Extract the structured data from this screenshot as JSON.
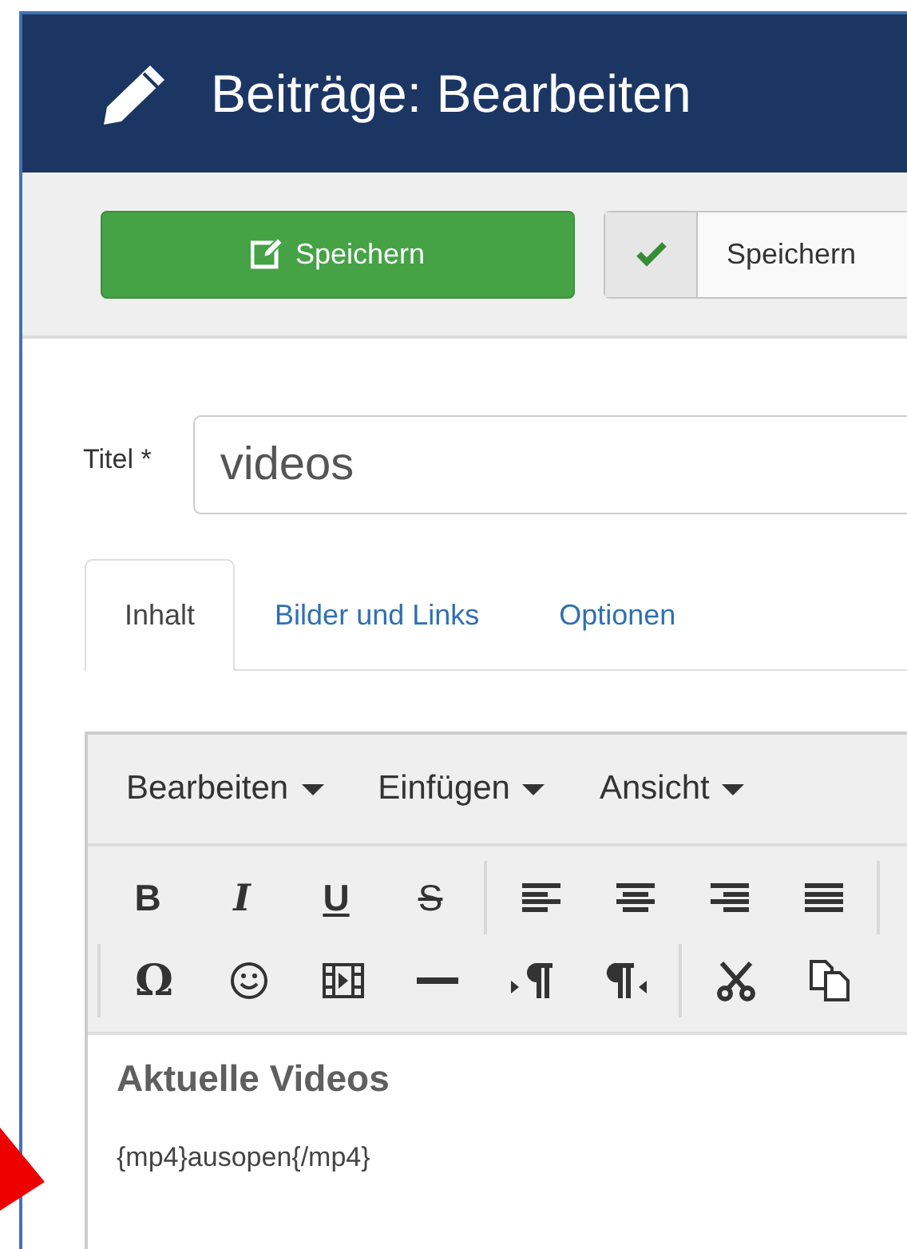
{
  "header": {
    "title": "Beiträge: Bearbeiten"
  },
  "toolbar": {
    "buttons": [
      {
        "kind": "primary",
        "label": "Speichern"
      },
      {
        "kind": "check",
        "label": "Speichern"
      }
    ]
  },
  "title_field": {
    "label": "Titel *",
    "value": "videos"
  },
  "tabs": [
    {
      "label": "Inhalt",
      "selected": true
    },
    {
      "label": "Bilder und Links",
      "selected": false
    },
    {
      "label": "Optionen",
      "selected": false
    }
  ],
  "editor": {
    "menus": [
      "Bearbeiten",
      "Einfügen",
      "Ansicht"
    ],
    "format_toolbar": [
      {
        "kind": "bold",
        "text": "B"
      },
      {
        "kind": "italic",
        "text": "I"
      },
      {
        "kind": "underline",
        "text": "U"
      },
      {
        "kind": "strike",
        "text": "S"
      },
      {
        "kind": "sep"
      },
      {
        "kind": "align-left"
      },
      {
        "kind": "align-center"
      },
      {
        "kind": "align-right"
      },
      {
        "kind": "justify"
      },
      {
        "kind": "sep"
      }
    ],
    "insert_toolbar": [
      {
        "kind": "sep"
      },
      {
        "kind": "special",
        "text": "Ω"
      },
      {
        "kind": "smiley"
      },
      {
        "kind": "film"
      },
      {
        "kind": "hr"
      },
      {
        "kind": "ltr"
      },
      {
        "kind": "rtl"
      },
      {
        "kind": "sep"
      },
      {
        "kind": "cut"
      },
      {
        "kind": "copy"
      }
    ],
    "heading": "Aktuelle Videos",
    "paragraph": "{mp4}ausopen{/mp4}"
  }
}
